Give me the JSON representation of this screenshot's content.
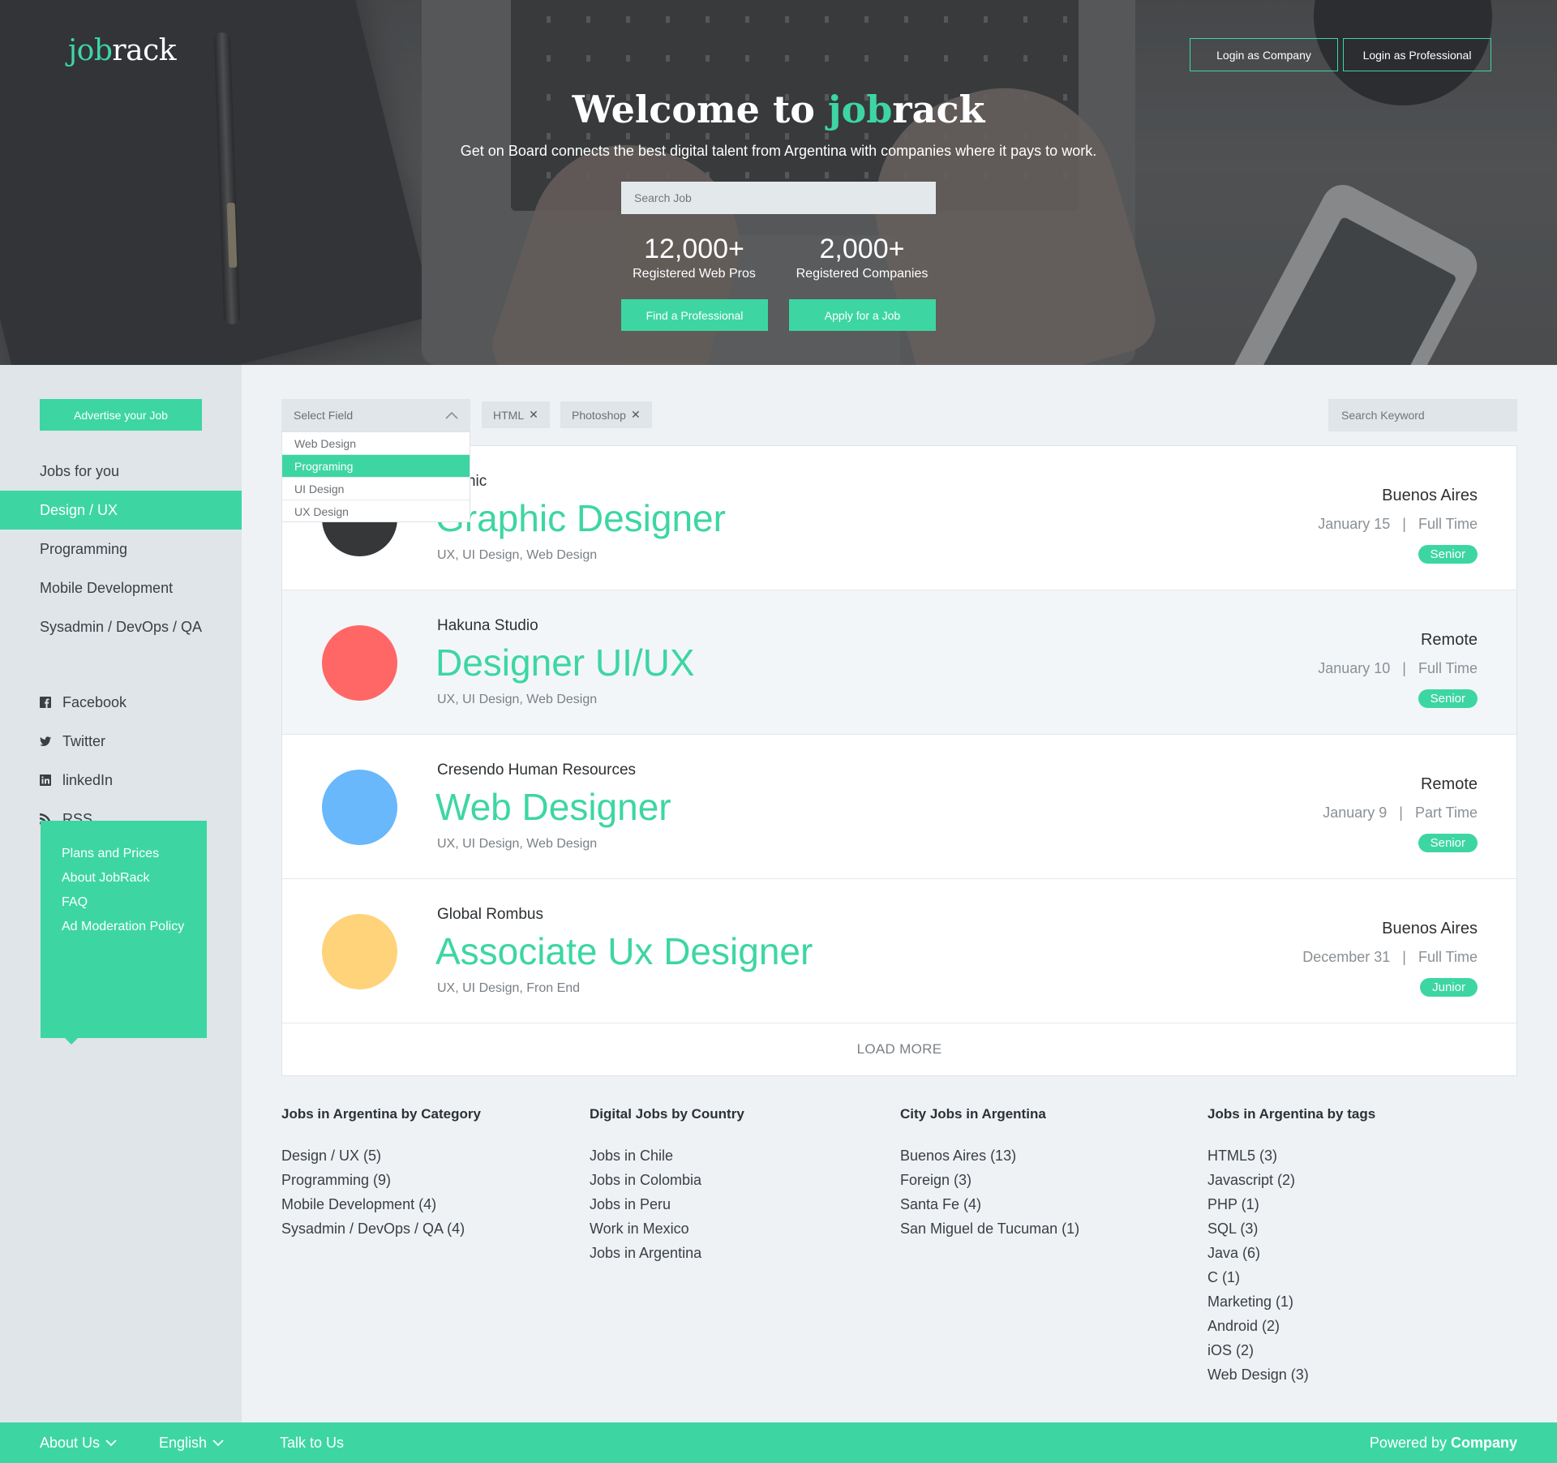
{
  "brand": {
    "logo_part1": "job",
    "logo_part2": "rack",
    "accent_color": "#3dd6a3"
  },
  "header": {
    "login_company": "Login as Company",
    "login_professional": "Login as Professional"
  },
  "hero": {
    "title_prefix": "Welcome to ",
    "title_accent": "job",
    "title_rest": "rack",
    "subtitle": "Get on Board connects the best digital talent from Argentina with companies where it pays to work.",
    "search_placeholder": "Search Job",
    "stats": [
      {
        "num": "12,000+",
        "label": "Registered Web Pros"
      },
      {
        "num": "2,000+",
        "label": "Registered Companies"
      }
    ],
    "find_professional": "Find a Professional",
    "apply_job": "Apply for a Job"
  },
  "sidebar": {
    "advertise": "Advertise your Job",
    "nav": [
      {
        "label": "Jobs for you",
        "active": false
      },
      {
        "label": "Design / UX",
        "active": true
      },
      {
        "label": "Programming",
        "active": false
      },
      {
        "label": "Mobile Development",
        "active": false
      },
      {
        "label": "Sysadmin / DevOps / QA",
        "active": false
      }
    ],
    "social": [
      {
        "label": "Facebook",
        "icon": "facebook-icon"
      },
      {
        "label": "Twitter",
        "icon": "twitter-icon"
      },
      {
        "label": "linkedIn",
        "icon": "linkedin-icon"
      },
      {
        "label": "RSS",
        "icon": "rss-icon"
      }
    ],
    "links": [
      "Plans and Prices",
      "About JobRack",
      "FAQ",
      "Ad Moderation Policy"
    ]
  },
  "filters": {
    "select_placeholder": "Select Field",
    "options": [
      {
        "label": "Web Design",
        "selected": false
      },
      {
        "label": "Programing",
        "selected": true
      },
      {
        "label": "UI Design",
        "selected": false
      },
      {
        "label": "UX Design",
        "selected": false
      }
    ],
    "chips": [
      "HTML",
      "Photoshop"
    ],
    "keyword_placeholder": "Search Keyword"
  },
  "jobs": [
    {
      "company": "ePicnic",
      "title": "Graphic Designer",
      "tags": "UX, UI Design, Web Design",
      "location": "Buenos Aires",
      "date": "January 15",
      "type": "Full Time",
      "level": "Senior",
      "color": "#363738"
    },
    {
      "company": "Hakuna Studio",
      "title": "Designer UI/UX",
      "tags": "UX, UI Design, Web Design",
      "location": "Remote",
      "date": "January 10",
      "type": "Full Time",
      "level": "Senior",
      "color": "#ff6766"
    },
    {
      "company": "Cresendo Human Resources",
      "title": "Web Designer",
      "tags": "UX, UI Design, Web Design",
      "location": "Remote",
      "date": "January 9",
      "type": "Part Time",
      "level": "Senior",
      "color": "#68b8fb"
    },
    {
      "company": "Global Rombus",
      "title": "Associate Ux Designer",
      "tags": "UX, UI Design, Fron End",
      "location": "Buenos Aires",
      "date": "December 31",
      "type": "Full Time",
      "level": "Junior",
      "color": "#ffd37a"
    }
  ],
  "load_more": "LOAD MORE",
  "columns": [
    {
      "title": "Jobs in Argentina by Category",
      "links": [
        "Design / UX (5)",
        "Programming (9)",
        "Mobile Development (4)",
        "Sysadmin / DevOps / QA (4)"
      ]
    },
    {
      "title": "Digital Jobs by Country",
      "links": [
        "Jobs in Chile",
        "Jobs in Colombia",
        "Jobs in Peru",
        "Work in Mexico",
        "Jobs in Argentina"
      ]
    },
    {
      "title": "City Jobs in Argentina",
      "links": [
        "Buenos Aires (13)",
        "Foreign (3)",
        "Santa Fe (4)",
        "San Miguel de Tucuman (1)"
      ]
    },
    {
      "title": "Jobs in Argentina by tags",
      "links": [
        "HTML5 (3)",
        "Javascript (2)",
        "PHP (1)",
        "SQL (3)",
        "Java (6)",
        "C (1)",
        "Marketing (1)",
        "Android (2)",
        "iOS (2)",
        "Web Design (3)"
      ]
    }
  ],
  "footer": {
    "about": "About Us",
    "language": "English",
    "talk": "Talk to Us",
    "powered_by": "Powered by",
    "company": "Company"
  }
}
